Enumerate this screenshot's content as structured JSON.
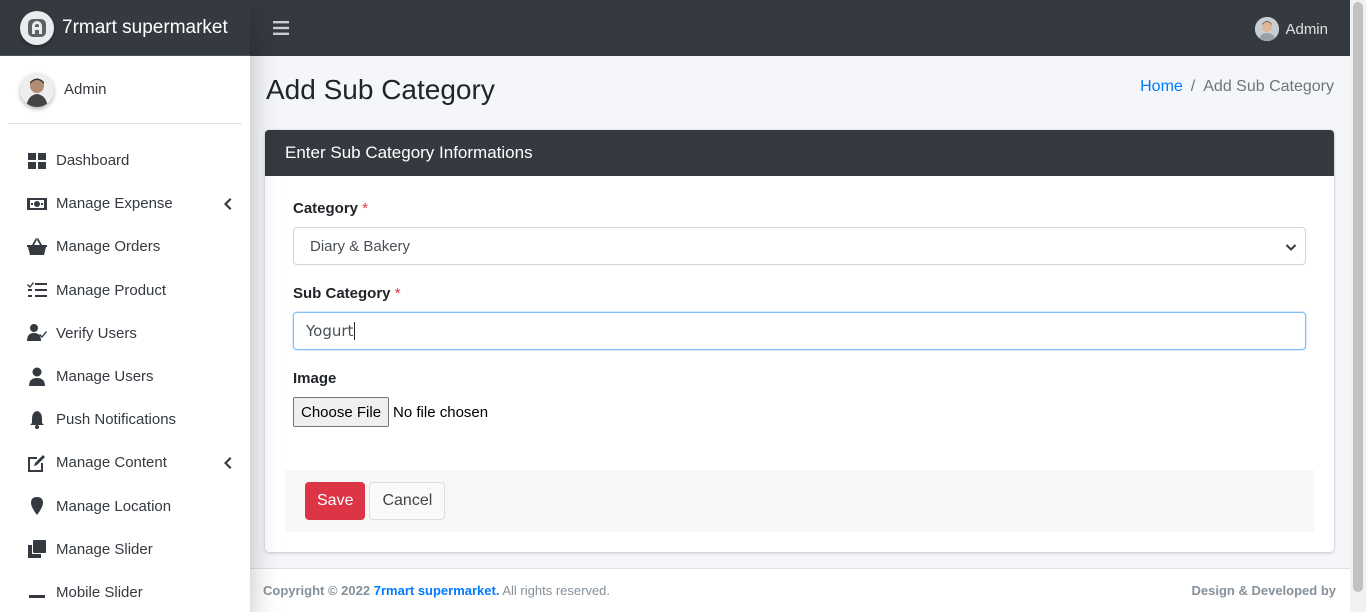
{
  "brand": {
    "name": "7rmart supermarket",
    "logo_icon": "brand-logo-icon"
  },
  "user_panel": {
    "name": "Admin"
  },
  "topbar": {
    "menu_icon": "hamburger-icon",
    "user_name": "Admin"
  },
  "sidebar": {
    "items": [
      {
        "label": "Dashboard",
        "icon": "dashboard-icon",
        "has_submenu": false
      },
      {
        "label": "Manage Expense",
        "icon": "money-bill-icon",
        "has_submenu": true
      },
      {
        "label": "Manage Orders",
        "icon": "shopping-basket-icon",
        "has_submenu": false
      },
      {
        "label": "Manage Product",
        "icon": "tasks-list-icon",
        "has_submenu": false
      },
      {
        "label": "Verify Users",
        "icon": "user-check-icon",
        "has_submenu": false
      },
      {
        "label": "Manage Users",
        "icon": "user-icon",
        "has_submenu": false
      },
      {
        "label": "Push Notifications",
        "icon": "bell-icon",
        "has_submenu": false
      },
      {
        "label": "Manage Content",
        "icon": "edit-icon",
        "has_submenu": true
      },
      {
        "label": "Manage Location",
        "icon": "map-marker-icon",
        "has_submenu": false
      },
      {
        "label": "Manage Slider",
        "icon": "clone-icon",
        "has_submenu": false
      },
      {
        "label": "Mobile Slider",
        "icon": "minus-icon",
        "has_submenu": false
      }
    ]
  },
  "page": {
    "title": "Add Sub Category",
    "breadcrumb": {
      "home": "Home",
      "separator": "/",
      "current": "Add Sub Category"
    }
  },
  "form": {
    "card_title": "Enter Sub Category Informations",
    "category": {
      "label": "Category",
      "required_mark": "*",
      "selected": "Diary & Bakery"
    },
    "sub_category": {
      "label": "Sub Category",
      "required_mark": "*",
      "value": "Yogurt"
    },
    "image": {
      "label": "Image",
      "button": "Choose File",
      "status": "No file chosen"
    },
    "save_label": "Save",
    "cancel_label": "Cancel"
  },
  "footer": {
    "copyright_prefix": "Copyright © 2022",
    "company": "7rmart supermarket.",
    "rights": "All rights reserved.",
    "credit": "Design & Developed by"
  },
  "colors": {
    "dark": "#343a40",
    "primary": "#007bff",
    "danger": "#dc3545",
    "content_bg": "#f4f6f9"
  }
}
